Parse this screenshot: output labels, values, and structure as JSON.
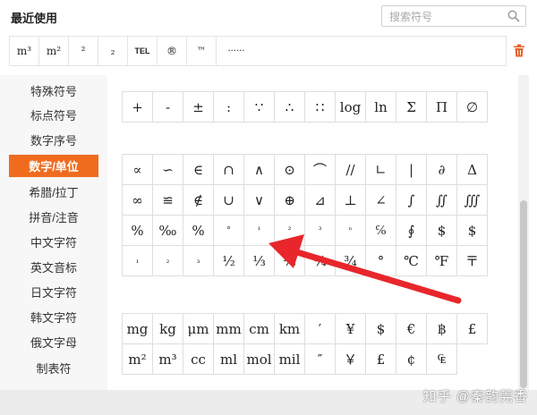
{
  "header": {
    "title": "最近使用",
    "search_placeholder": "搜索符号"
  },
  "recent": [
    "m³",
    "m²",
    "²",
    "₂",
    "TEL",
    "®",
    "™",
    "······"
  ],
  "sidebar": {
    "items": [
      "特殊符号",
      "标点符号",
      "数字序号",
      "数字/单位",
      "希腊/拉丁",
      "拼音/注音",
      "中文字符",
      "英文音标",
      "日文字符",
      "韩文字符",
      "俄文字母",
      "制表符"
    ],
    "active": "数字/单位"
  },
  "grids": [
    {
      "name": "math-grid",
      "rows": [
        [
          "+",
          "-",
          "±",
          ":",
          "∵",
          "∴",
          "∷",
          "log",
          "ln",
          "Σ",
          "Π",
          "∅"
        ]
      ]
    },
    {
      "name": "symbol-grid",
      "rows": [
        [
          "∝",
          "∽",
          "∈",
          "∩",
          "∧",
          "⊙",
          "⌒",
          "//",
          "∟",
          "|",
          "∂",
          "Δ"
        ],
        [
          "∞",
          "≌",
          "∉",
          "∪",
          "∨",
          "⊕",
          "⊿",
          "⊥",
          "∠",
          "∫",
          "∬",
          "∭"
        ],
        [
          "%",
          "‰",
          "%",
          "°",
          "¹",
          "²",
          "³",
          "ⁿ",
          "℅",
          "∮",
          "$",
          "$"
        ],
        [
          "₁",
          "₂",
          "₃",
          "½",
          "⅓",
          "⅔",
          "¼",
          "¾",
          "°",
          "℃",
          "℉",
          "〒"
        ]
      ]
    },
    {
      "name": "unit-grid",
      "rows": [
        [
          "mg",
          "kg",
          "μm",
          "mm",
          "cm",
          "km",
          "′",
          "¥",
          "$",
          "€",
          "฿",
          "£"
        ],
        [
          "m²",
          "m³",
          "cc",
          "ml",
          "mol",
          "mil",
          "″",
          "￥",
          "£",
          "¢",
          "₠"
        ]
      ]
    }
  ],
  "watermark": "知乎 @秦韵莞香"
}
